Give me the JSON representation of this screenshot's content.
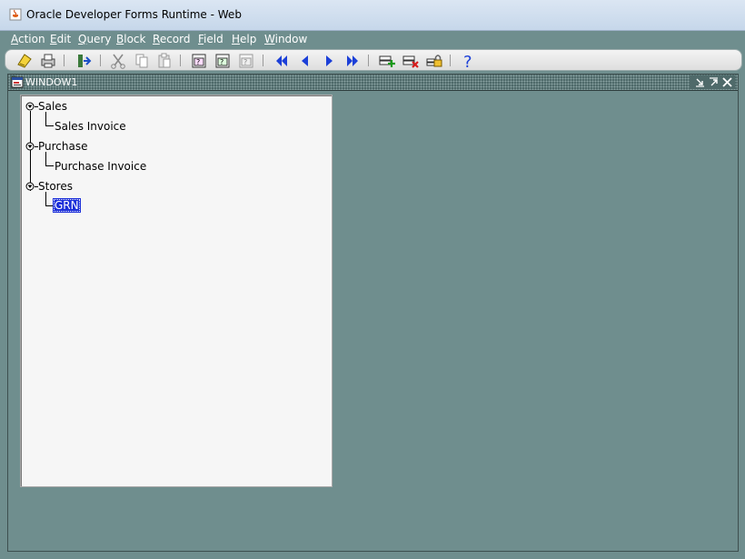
{
  "window": {
    "title": "Oracle Developer Forms Runtime - Web"
  },
  "menu": {
    "items": [
      {
        "u": "A",
        "rest": "ction"
      },
      {
        "u": "E",
        "rest": "dit"
      },
      {
        "u": "Q",
        "rest": "uery"
      },
      {
        "u": "B",
        "rest": "lock"
      },
      {
        "u": "R",
        "rest": "ecord"
      },
      {
        "u": "F",
        "rest": "ield"
      },
      {
        "u": "H",
        "rest": "elp"
      },
      {
        "u": "W",
        "rest": "indow"
      }
    ]
  },
  "toolbar": {
    "icons": [
      "save-icon",
      "print-icon",
      "exit-icon",
      "cut-icon",
      "copy-icon",
      "paste-icon",
      "enter-query-icon",
      "execute-query-icon",
      "cancel-query-icon",
      "previous-block-icon",
      "previous-record-icon",
      "next-record-icon",
      "next-block-icon",
      "insert-record-icon",
      "delete-record-icon",
      "lock-record-icon",
      "help-icon"
    ]
  },
  "mdi_window": {
    "title": "WINDOW1"
  },
  "tree": {
    "nodes": [
      {
        "label": "Sales",
        "children": [
          {
            "label": "Sales Invoice"
          }
        ]
      },
      {
        "label": "Purchase",
        "children": [
          {
            "label": "Purchase Invoice"
          }
        ]
      },
      {
        "label": "Stores",
        "children": [
          {
            "label": "GRN",
            "selected": true
          }
        ]
      }
    ]
  },
  "colors": {
    "background": "#6f8e8e",
    "selection": "#1c2fd9"
  }
}
